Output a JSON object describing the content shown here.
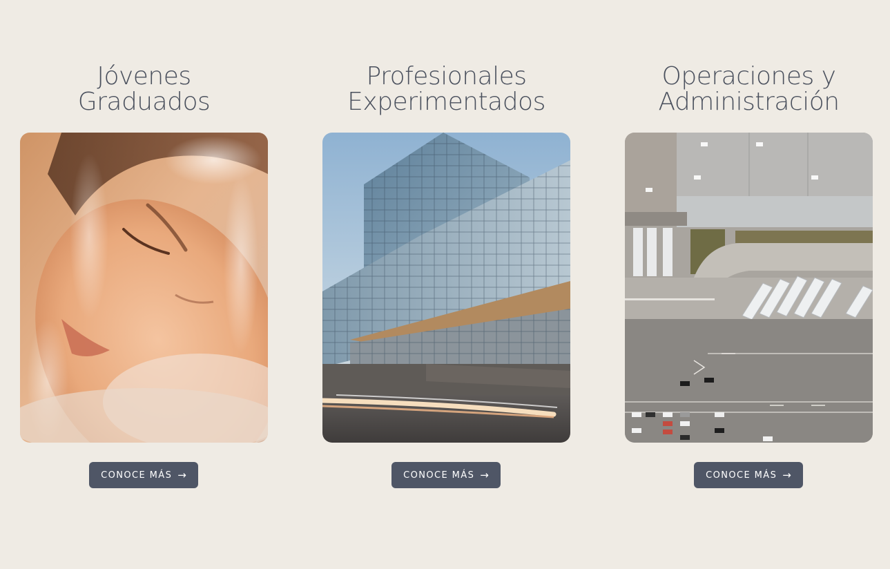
{
  "colors": {
    "background": "#efebe4",
    "title_text": "#4a505d",
    "button_background": "#4f5666",
    "button_text": "#ffffff"
  },
  "cards": [
    {
      "title_line1": "Jóvenes",
      "title_line2": "Graduados",
      "image": "portrait-photo",
      "button_label": "CONOCE MÁS",
      "button_icon": "arrow-right-icon"
    },
    {
      "title_line1": "Profesionales",
      "title_line2": "Experimentados",
      "image": "glass-building-photo",
      "button_label": "CONOCE MÁS",
      "button_icon": "arrow-right-icon"
    },
    {
      "title_line1": "Operaciones y",
      "title_line2": "Administración",
      "image": "aerial-warehouse-photo",
      "button_label": "CONOCE MÁS",
      "button_icon": "arrow-right-icon"
    }
  ]
}
